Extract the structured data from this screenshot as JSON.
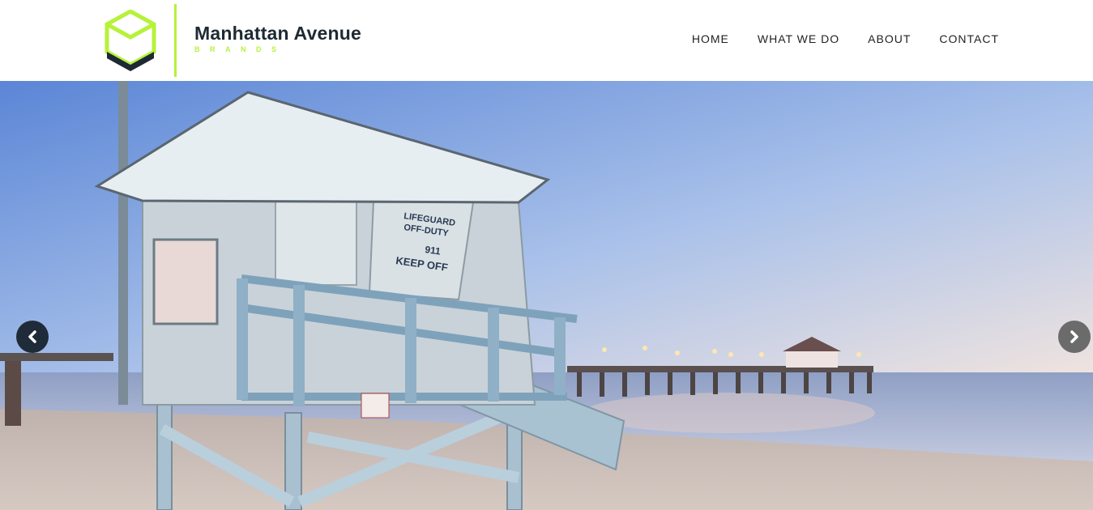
{
  "brand": {
    "name": "Manhattan Avenue",
    "subtitle": "BRANDS",
    "accent_color": "#b6f23a",
    "dark_color": "#1e2a33"
  },
  "nav": {
    "items": [
      {
        "label": "HOME"
      },
      {
        "label": "WHAT WE DO"
      },
      {
        "label": "ABOUT"
      },
      {
        "label": "CONTACT"
      }
    ]
  },
  "hero": {
    "sign": {
      "line1": "LIFEGUARD",
      "line2": "OFF-DUTY",
      "line3": "911",
      "line4": "KEEP OFF"
    },
    "prev_icon": "chevron-left-icon",
    "next_icon": "chevron-right-icon"
  }
}
